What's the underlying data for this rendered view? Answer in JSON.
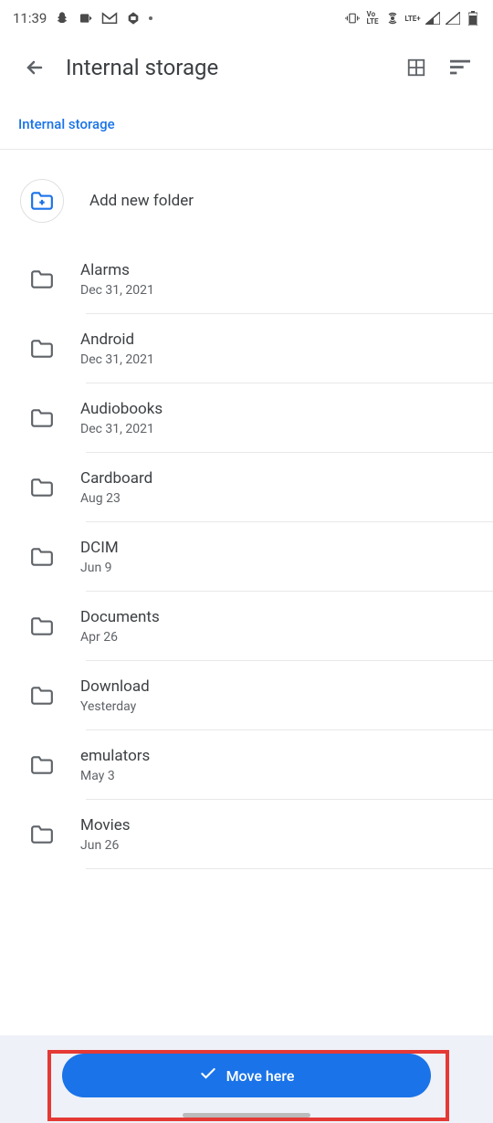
{
  "status": {
    "time": "11:39",
    "icons_left": [
      "snapchat-icon",
      "clock-alert-icon",
      "gmail-icon",
      "print-icon"
    ],
    "icons_right": [
      "vibrate-icon",
      "volte-icon",
      "hotspot-icon",
      "lte-plus-icon",
      "signal-icon-1",
      "signal-icon-2",
      "battery-icon"
    ]
  },
  "appbar": {
    "title": "Internal storage"
  },
  "breadcrumb": {
    "label": "Internal storage"
  },
  "add_folder": {
    "label": "Add new folder"
  },
  "folders": [
    {
      "name": "Alarms",
      "date": "Dec 31, 2021"
    },
    {
      "name": "Android",
      "date": "Dec 31, 2021"
    },
    {
      "name": "Audiobooks",
      "date": "Dec 31, 2021"
    },
    {
      "name": "Cardboard",
      "date": "Aug 23"
    },
    {
      "name": "DCIM",
      "date": "Jun 9"
    },
    {
      "name": "Documents",
      "date": "Apr 26"
    },
    {
      "name": "Download",
      "date": "Yesterday"
    },
    {
      "name": "emulators",
      "date": "May 3"
    },
    {
      "name": "Movies",
      "date": "Jun 26"
    }
  ],
  "action_button": {
    "label": "Move here"
  }
}
